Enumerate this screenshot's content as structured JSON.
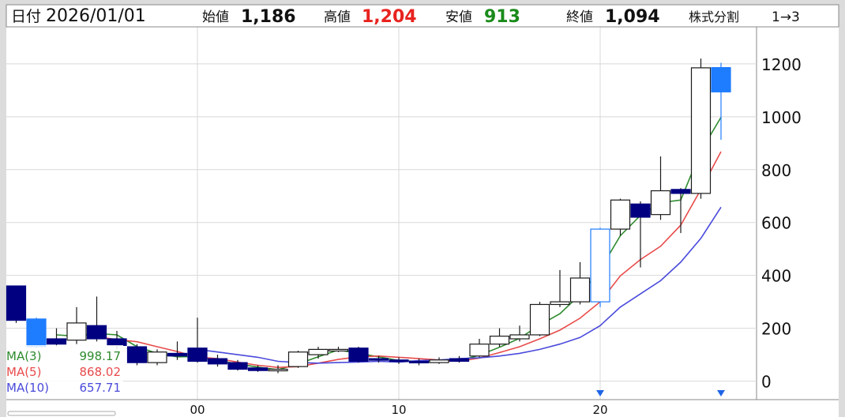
{
  "header": {
    "date_label": "日付",
    "date_value": "2026/01/01",
    "open_label": "始値",
    "open_value": "1,186",
    "high_label": "高値",
    "high_value": "1,204",
    "low_label": "安値",
    "low_value": "913",
    "close_label": "終値",
    "close_value": "1,094",
    "split_label": "株式分割",
    "split_value": "1→3"
  },
  "legend": {
    "ma3_label": "MA(3)",
    "ma3_value": "998.17",
    "ma5_label": "MA(5)",
    "ma5_value": "868.02",
    "ma10_label": "MA(10)",
    "ma10_value": "657.71"
  },
  "colors": {
    "up_body": "#ffffff",
    "down_body": "#000080",
    "highlight_body": "#1e7cff",
    "wick": "#1a1a1a",
    "highlight_wick": "#1e7cff",
    "ma3": "#2e8b2e",
    "ma5": "#e84b4b",
    "ma10": "#4a4adc",
    "high_text": "#e8231f",
    "low_text": "#1a8a1a",
    "marker": "#1e64e6",
    "grid": "#d8d8d8"
  },
  "chart_data": {
    "type": "candlestick",
    "y_ticks": [
      0,
      200,
      400,
      600,
      800,
      1000,
      1200
    ],
    "y_tick_labels": [
      "0",
      "200",
      "400",
      "600",
      "800",
      "1000",
      "1200"
    ],
    "x_ticks": [
      {
        "index": 9,
        "label": "00"
      },
      {
        "index": 19,
        "label": "10"
      },
      {
        "index": 29,
        "label": "20"
      }
    ],
    "ylim": [
      -70,
      1340
    ],
    "split_markers": [
      29,
      35
    ],
    "candles": [
      {
        "o": 360,
        "c": 230,
        "h": 360,
        "l": 220,
        "style": "down"
      },
      {
        "o": 235,
        "c": 130,
        "h": 240,
        "l": 125,
        "style": "highlight"
      },
      {
        "o": 160,
        "c": 140,
        "h": 200,
        "l": 130,
        "style": "down"
      },
      {
        "o": 155,
        "c": 220,
        "h": 280,
        "l": 140,
        "style": "up"
      },
      {
        "o": 210,
        "c": 160,
        "h": 320,
        "l": 150,
        "style": "down"
      },
      {
        "o": 160,
        "c": 135,
        "h": 190,
        "l": 120,
        "style": "down"
      },
      {
        "o": 130,
        "c": 70,
        "h": 140,
        "l": 60,
        "style": "down"
      },
      {
        "o": 70,
        "c": 110,
        "h": 120,
        "l": 60,
        "style": "up"
      },
      {
        "o": 105,
        "c": 95,
        "h": 150,
        "l": 80,
        "style": "down"
      },
      {
        "o": 125,
        "c": 75,
        "h": 240,
        "l": 70,
        "style": "down"
      },
      {
        "o": 85,
        "c": 65,
        "h": 100,
        "l": 55,
        "style": "down"
      },
      {
        "o": 70,
        "c": 45,
        "h": 80,
        "l": 40,
        "style": "down"
      },
      {
        "o": 50,
        "c": 40,
        "h": 60,
        "l": 35,
        "style": "down"
      },
      {
        "o": 40,
        "c": 45,
        "h": 60,
        "l": 30,
        "style": "up"
      },
      {
        "o": 55,
        "c": 110,
        "h": 115,
        "l": 50,
        "style": "up"
      },
      {
        "o": 100,
        "c": 120,
        "h": 130,
        "l": 85,
        "style": "up"
      },
      {
        "o": 120,
        "c": 120,
        "h": 130,
        "l": 110,
        "style": "doji"
      },
      {
        "o": 125,
        "c": 75,
        "h": 130,
        "l": 70,
        "style": "down"
      },
      {
        "o": 85,
        "c": 80,
        "h": 95,
        "l": 70,
        "style": "down"
      },
      {
        "o": 80,
        "c": 75,
        "h": 90,
        "l": 65,
        "style": "down"
      },
      {
        "o": 75,
        "c": 70,
        "h": 85,
        "l": 60,
        "style": "down"
      },
      {
        "o": 70,
        "c": 80,
        "h": 90,
        "l": 65,
        "style": "up"
      },
      {
        "o": 85,
        "c": 75,
        "h": 95,
        "l": 70,
        "style": "down"
      },
      {
        "o": 95,
        "c": 140,
        "h": 160,
        "l": 90,
        "style": "up"
      },
      {
        "o": 140,
        "c": 170,
        "h": 200,
        "l": 130,
        "style": "up"
      },
      {
        "o": 160,
        "c": 175,
        "h": 210,
        "l": 150,
        "style": "up"
      },
      {
        "o": 175,
        "c": 290,
        "h": 300,
        "l": 170,
        "style": "up"
      },
      {
        "o": 290,
        "c": 300,
        "h": 420,
        "l": 280,
        "style": "up"
      },
      {
        "o": 300,
        "c": 390,
        "h": 450,
        "l": 290,
        "style": "up"
      },
      {
        "o": 300,
        "c": 575,
        "h": 580,
        "l": 280,
        "style": "highlight_up"
      },
      {
        "o": 575,
        "c": 685,
        "h": 690,
        "l": 550,
        "style": "up"
      },
      {
        "o": 670,
        "c": 620,
        "h": 680,
        "l": 430,
        "style": "down"
      },
      {
        "o": 630,
        "c": 720,
        "h": 850,
        "l": 610,
        "style": "up"
      },
      {
        "o": 725,
        "c": 710,
        "h": 730,
        "l": 560,
        "style": "down"
      },
      {
        "o": 710,
        "c": 1185,
        "h": 1220,
        "l": 690,
        "style": "up"
      },
      {
        "o": 1186,
        "c": 1094,
        "h": 1204,
        "l": 913,
        "style": "highlight"
      }
    ],
    "ma_series": [
      {
        "name": "MA(3)",
        "values": [
          null,
          null,
          175,
          170,
          180,
          175,
          130,
          105,
          92,
          93,
          78,
          65,
          53,
          43,
          65,
          92,
          118,
          105,
          92,
          78,
          75,
          75,
          77,
          98,
          128,
          162,
          212,
          255,
          327,
          422,
          550,
          627,
          675,
          685,
          870,
          998
        ]
      },
      {
        "name": "MA(5)",
        "values": [
          null,
          null,
          null,
          null,
          168,
          157,
          149,
          130,
          112,
          91,
          85,
          72,
          60,
          52,
          55,
          68,
          82,
          92,
          95,
          90,
          85,
          80,
          75,
          87,
          108,
          130,
          160,
          193,
          238,
          300,
          398,
          460,
          510,
          590,
          725,
          868
        ]
      },
      {
        "name": "MA(10)",
        "values": [
          null,
          null,
          null,
          null,
          null,
          null,
          null,
          null,
          null,
          120,
          110,
          100,
          90,
          75,
          70,
          68,
          70,
          72,
          75,
          72,
          78,
          80,
          85,
          88,
          95,
          105,
          120,
          140,
          165,
          210,
          280,
          330,
          380,
          450,
          540,
          658
        ]
      }
    ]
  }
}
